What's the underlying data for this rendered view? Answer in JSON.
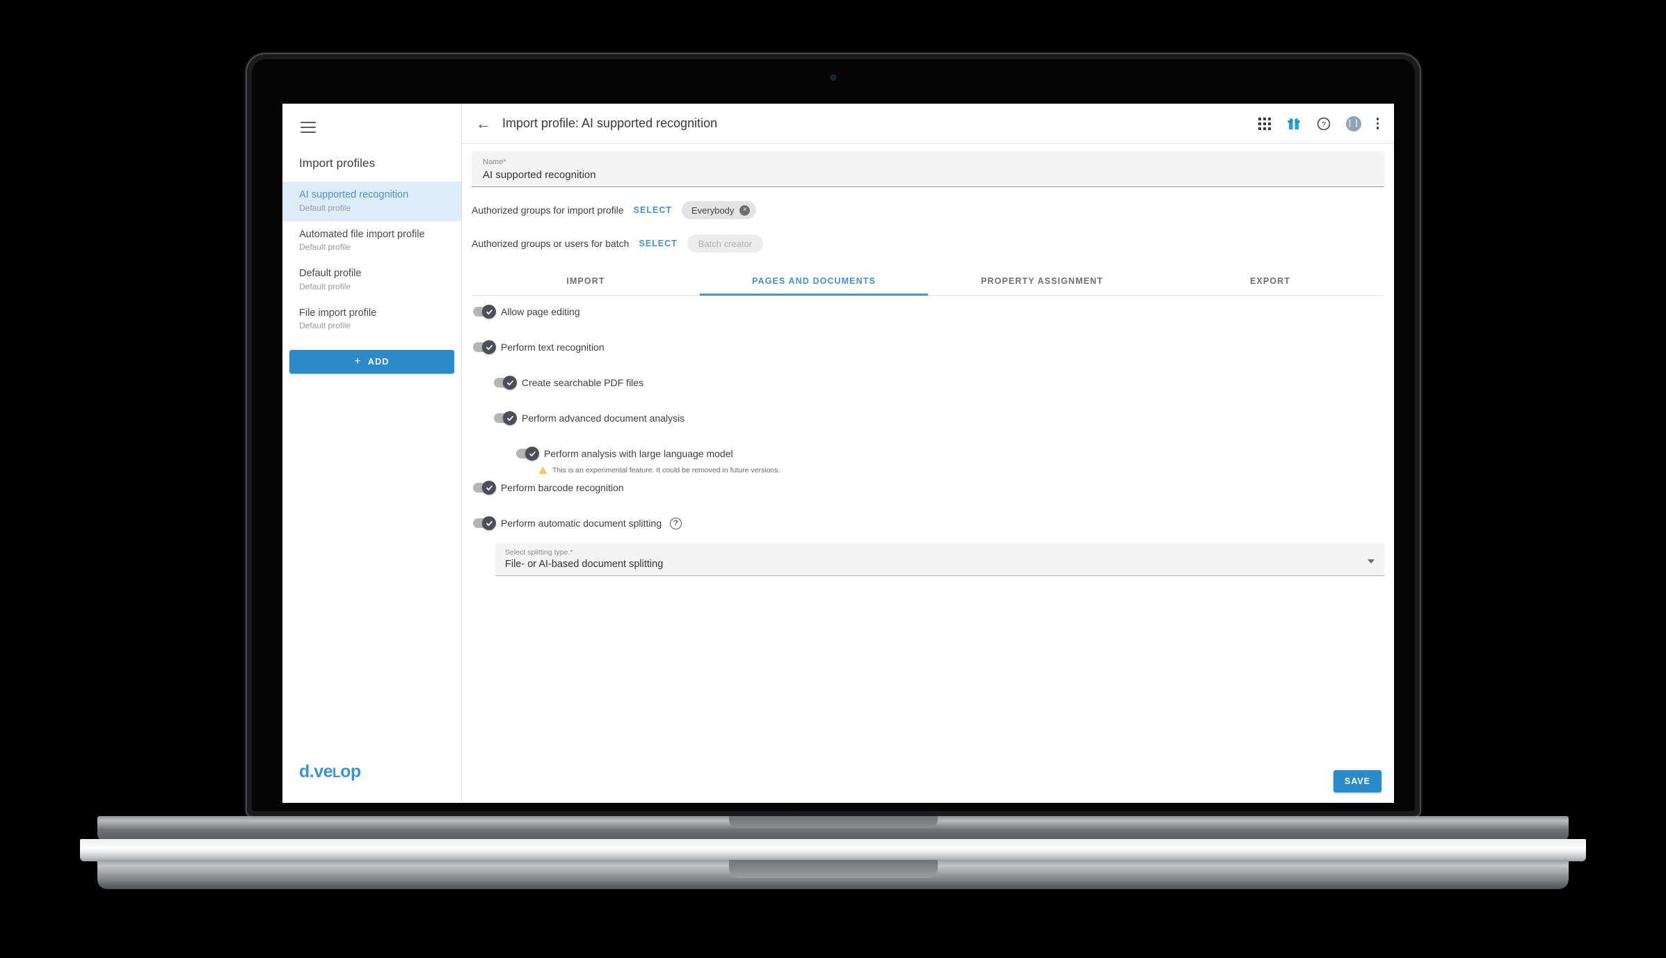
{
  "window": {
    "device": "laptop"
  },
  "sidebar": {
    "menu_icon": "hamburger-icon",
    "title": "Import profiles",
    "items": [
      {
        "name": "AI supported recognition",
        "sub": "Default profile",
        "active": true
      },
      {
        "name": "Automated file import profile",
        "sub": "Default profile",
        "active": false
      },
      {
        "name": "Default profile",
        "sub": "Default profile",
        "active": false
      },
      {
        "name": "File import profile",
        "sub": "Default profile",
        "active": false
      }
    ],
    "add_button": {
      "plus": "+",
      "label": "ADD"
    },
    "brand": {
      "part1": "d.ve",
      "part2": "L",
      "part3": "op"
    }
  },
  "topbar": {
    "back_icon": "arrow-left-icon",
    "title": "Import profile: AI supported recognition",
    "icons": [
      {
        "name": "apps-grid-icon"
      },
      {
        "name": "gift-icon"
      },
      {
        "name": "help-circle-icon"
      },
      {
        "name": "user-avatar-icon"
      },
      {
        "name": "more-vertical-icon"
      }
    ]
  },
  "form": {
    "name_field": {
      "label": "Name*",
      "value": "AI supported recognition"
    },
    "auth_rows": [
      {
        "label": "Authorized groups for import profile",
        "select_label": "SELECT",
        "chip": "Everybody",
        "chip_ghost": false,
        "chip_remove": "×"
      },
      {
        "label": "Authorized groups or users for batch",
        "select_label": "SELECT",
        "chip": "Batch creator",
        "chip_ghost": true,
        "chip_remove": ""
      }
    ]
  },
  "tabs": [
    {
      "label": "IMPORT",
      "active": false
    },
    {
      "label": "PAGES AND DOCUMENTS",
      "active": true
    },
    {
      "label": "PROPERTY ASSIGNMENT",
      "active": false
    },
    {
      "label": "EXPORT",
      "active": false
    }
  ],
  "settings": {
    "toggles": [
      {
        "label": "Allow page editing",
        "level": 0,
        "on": true,
        "help": false
      },
      {
        "label": "Perform text recognition",
        "level": 0,
        "on": true,
        "help": false
      },
      {
        "label": "Create searchable PDF files",
        "level": 1,
        "on": true,
        "help": false
      },
      {
        "label": "Perform advanced document analysis",
        "level": 1,
        "on": true,
        "help": false
      },
      {
        "label": "Perform analysis with large language model",
        "level": 2,
        "on": true,
        "help": false
      },
      {
        "label": "Perform barcode recognition",
        "level": 0,
        "on": true,
        "help": false
      },
      {
        "label": "Perform automatic document splitting",
        "level": 0,
        "on": true,
        "help": true
      }
    ],
    "warning": {
      "icon": "warning-triangle-icon",
      "text": "This is an experimental feature. It could be removed in future versions."
    },
    "help_glyph": "?",
    "splitting_dropdown": {
      "label": "Select splitting type.*",
      "value": "File- or AI-based document splitting",
      "caret": "chevron-down-icon"
    }
  },
  "footer": {
    "save_label": "SAVE"
  },
  "colors": {
    "accent": "#2a8bc8",
    "tab_active": "#4a90c9",
    "sidebar_active_bg": "#ddecf8",
    "brand": "#3e92cf",
    "toggle_knob": "#4b4f56",
    "toggle_track": "#b5b5b5",
    "warning": "#f5c144"
  }
}
